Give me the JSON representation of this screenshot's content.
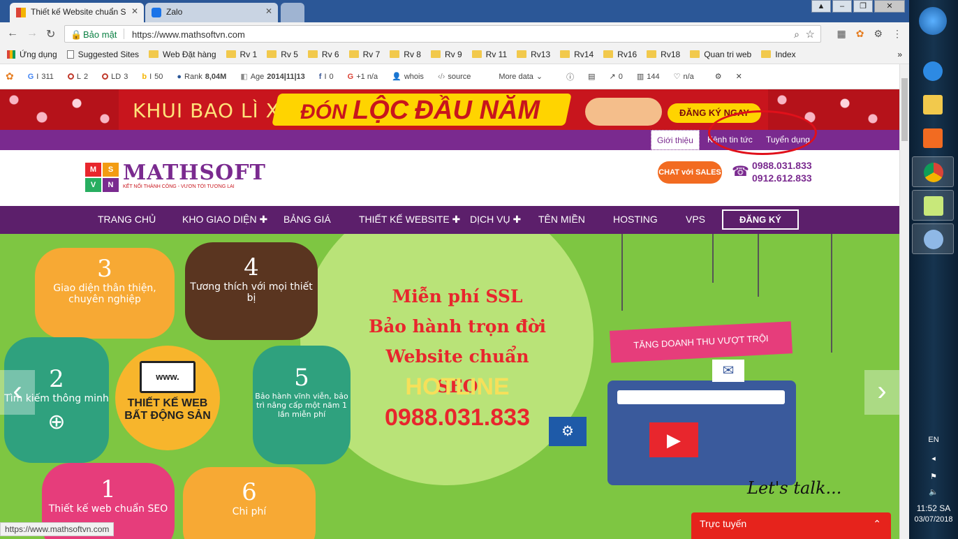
{
  "browser": {
    "tabs": [
      {
        "title": "Thiết kế Website chuẩn S"
      },
      {
        "title": "Zalo"
      }
    ],
    "secure_label": "Bảo mật",
    "url": "https://www.mathsoftvn.com",
    "bookmarks": [
      "Ứng dụng",
      "Suggested Sites",
      "Web Đặt hàng",
      "Rv 1",
      "Rv 5",
      "Rv 6",
      "Rv 7",
      "Rv 8",
      "Rv 9",
      "Rv 11",
      "Rv13",
      "Rv14",
      "Rv16",
      "Rv18",
      "Quan tri web",
      "Index"
    ],
    "more_bookmarks": "»"
  },
  "seobar": {
    "g": "311",
    "l": "2",
    "ld": "3",
    "b": "50",
    "rank_label": "Rank",
    "rank": "8,04M",
    "age_label": "Age",
    "age": "2014|11|13",
    "fb": "0",
    "gplus": "+1 n/a",
    "whois": "whois",
    "source": "source",
    "more": "More data",
    "out": "0",
    "links": "144",
    "na": "n/a"
  },
  "banner": {
    "left": "KHUI BAO LÌ XÌ",
    "mid_a": "ĐÓN",
    "mid_b": "LỘC",
    "mid_c": "ĐẦU NĂM",
    "cta": "ĐĂNG KÝ NGAY"
  },
  "topnav": [
    "Giới thiệu",
    "Kênh tin tức",
    "Tuyển dụng"
  ],
  "header": {
    "logo_letters": [
      "M",
      "S",
      "V",
      "N"
    ],
    "logo_name": "MATHSOFT",
    "tagline": "KẾT NỐI THÀNH CÔNG - VƯƠN TỚI TƯƠNG LAI",
    "chat": "CHAT với SALES",
    "phone1": "0988.031.833",
    "phone2": "0912.612.833"
  },
  "mainnav": {
    "items": [
      "TRANG CHỦ",
      "KHO GIAO DIỆN ✚",
      "BẢNG GIÁ",
      "THIẾT KẾ WEBSITE ✚",
      "DỊCH VỤ ✚",
      "TÊN MIỀN",
      "HOSTING",
      "VPS"
    ],
    "cta": "ĐĂNG KÝ"
  },
  "hero": {
    "petals": [
      {
        "num": "3",
        "text": "Giao diện thân thiện, chuyên nghiệp"
      },
      {
        "num": "4",
        "text": "Tương thích với mọi thiết bị"
      },
      {
        "num": "2",
        "text": "Tìm kiếm thông minh"
      },
      {
        "num": "5",
        "text": "Bảo hành vĩnh viễn, bảo trì nâng cấp một năm 1 lần miễn phí"
      },
      {
        "num": "1",
        "text": "Thiết kế web chuẩn SEO"
      },
      {
        "num": "6",
        "text": "Chi phí"
      }
    ],
    "center_www": "www.",
    "center": "THIẾT KẾ WEB BẤT ĐỘNG SẢN",
    "line1": "Miễn phí SSL",
    "line2": "Bảo hành trọn đời",
    "line3": "Website chuẩn SEO",
    "hotline_label": "HOTLINE",
    "hotline": "0988.031.833",
    "sign": "TĂNG DOANH THU VƯỢT TRỘI",
    "lets_talk": "Let's talk..."
  },
  "status_url": "https://www.mathsoftvn.com",
  "livechat": "Trực tuyến",
  "taskbar": {
    "lang": "EN",
    "time": "11:52 SA",
    "date": "03/07/2018"
  },
  "colors": {
    "brand_purple": "#7a2a8f",
    "nav_purple": "#5c1f6b",
    "banner_red": "#c8151d",
    "hero_green": "#7ec642",
    "highlight_ring": "#e0101a"
  }
}
